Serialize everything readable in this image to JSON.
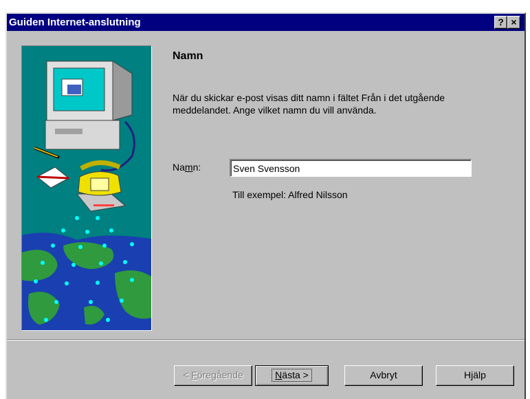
{
  "window": {
    "title": "Guiden Internet-anslutning",
    "help_button": "?",
    "close_button": "×"
  },
  "page": {
    "heading": "Namn",
    "description": "När du skickar e-post visas ditt namn i fältet Från i det utgående meddelandet. Ange vilket namn du vill använda.",
    "name_label_pre": "Na",
    "name_label_mnemonic": "m",
    "name_label_post": "n:",
    "name_value": "Sven Svensson",
    "example_text": "Till exempel: Alfred Nilsson"
  },
  "buttons": {
    "back_pre": "< ",
    "back_mnemonic": "F",
    "back_post": "öregående",
    "next_mnemonic": "N",
    "next_post": "ästa >",
    "cancel_label": "Avbryt",
    "help_label": "Hjälp"
  },
  "illustration": {
    "icons": [
      "computer-icon",
      "telephone-icon",
      "pen-icon",
      "envelope-icon",
      "globe-icon"
    ]
  },
  "colors": {
    "titlebar": "#000080",
    "window_face": "#c0c0c0",
    "illustration_bg": "#008080"
  }
}
